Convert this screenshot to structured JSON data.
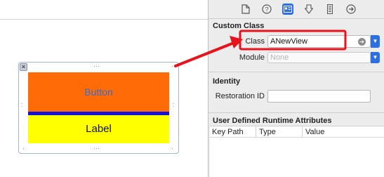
{
  "canvas": {
    "button_text": "Button",
    "label_text": "Label"
  },
  "inspector": {
    "toolbar_icons": [
      "file-icon",
      "help-icon",
      "identity-icon",
      "attributes-icon",
      "size-icon",
      "connections-icon"
    ],
    "custom_class": {
      "title": "Custom Class",
      "class_label": "Class",
      "class_value": "ANewView",
      "module_label": "Module",
      "module_placeholder": "None"
    },
    "identity": {
      "title": "Identity",
      "restoration_label": "Restoration ID",
      "restoration_value": ""
    },
    "runtime_attributes": {
      "title": "User Defined Runtime Attributes",
      "columns": [
        "Key Path",
        "Type",
        "Value"
      ]
    }
  },
  "colors": {
    "button_fill": "#ff6b06",
    "label_fill": "#ffff00",
    "strip": "#1212dd",
    "accent": "#2d6fe0",
    "arrow": "#e8121c"
  }
}
